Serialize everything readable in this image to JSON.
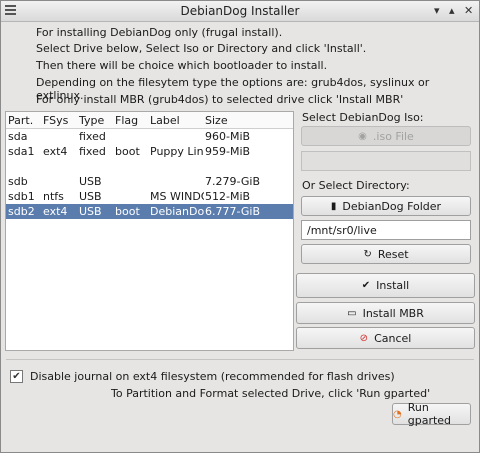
{
  "window": {
    "title": "DebianDog Installer",
    "controls": [
      "▾",
      "▴",
      "✕"
    ]
  },
  "instructions": [
    "For installing DebianDog only (frugal install).",
    "Select Drive below, Select Iso or Directory and click 'Install'.",
    "Then there will be choice which bootloader to install.",
    "Depending on the filesytem type the options are: grub4dos, syslinux or extlinux.",
    "For only install MBR (grub4dos) to selected drive click 'Install MBR'"
  ],
  "drive_list": {
    "columns": [
      "Part.",
      "FSys",
      "Type",
      "Flag",
      "Label",
      "Size"
    ],
    "rows": [
      {
        "part": "sda",
        "fsys": "",
        "type": "fixed",
        "flag": "",
        "label": "",
        "size": "960-MiB"
      },
      {
        "part": "sda1",
        "fsys": "ext4",
        "type": "fixed",
        "flag": "boot",
        "label": "Puppy Linux",
        "size": "959-MiB"
      },
      {
        "part": "",
        "fsys": "",
        "type": "",
        "flag": "",
        "label": "",
        "size": ""
      },
      {
        "part": "sdb",
        "fsys": "",
        "type": "USB",
        "flag": "",
        "label": "",
        "size": "7.279-GiB"
      },
      {
        "part": "sdb1",
        "fsys": "ntfs",
        "type": "USB",
        "flag": "",
        "label": "MS WINDOWS",
        "size": "512-MiB"
      },
      {
        "part": "sdb2",
        "fsys": "ext4",
        "type": "USB",
        "flag": "boot",
        "label": "DebianDog",
        "size": "6.777-GiB"
      }
    ],
    "selected_index": 5
  },
  "right_panel": {
    "iso_heading": "Select DebianDog Iso:",
    "iso_button": ".iso File",
    "iso_value": "",
    "dir_heading": "Or Select Directory:",
    "dir_button": "DebianDog Folder",
    "dir_value": "/mnt/sr0/live",
    "reset_button": "Reset"
  },
  "actions": {
    "install": "Install",
    "install_mbr": "Install MBR",
    "cancel": "Cancel"
  },
  "options": {
    "journal_label": "Disable journal on ext4 filesystem (recommended for flash drives)",
    "journal_checked": "✔",
    "partition_note": "To Partition and Format selected Drive, click 'Run gparted'",
    "gparted_button": "Run gparted"
  },
  "icons": {
    "iso": "cd-icon",
    "folder": "folder-icon",
    "reset": "reset-icon",
    "install": "check-circle-icon",
    "mbr": "drive-icon",
    "cancel": "cancel-icon",
    "gparted": "gparted-icon"
  },
  "colors": {
    "selection": "#5a7dad",
    "cancel_icon": "#d32f2f",
    "gparted_icon": "#e07020"
  }
}
